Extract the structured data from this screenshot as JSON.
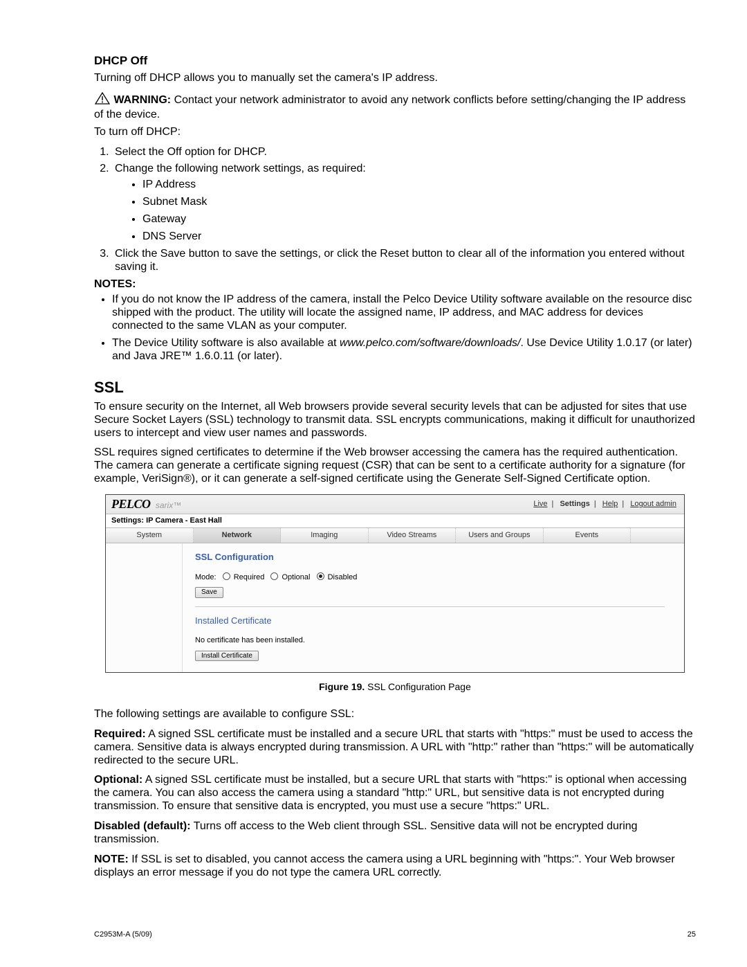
{
  "dhcp": {
    "heading": "DHCP Off",
    "intro": "Turning off DHCP allows you to manually set the camera's IP address.",
    "warning_label": "WARNING:",
    "warning_text": "Contact your network administrator to avoid any network conflicts before setting/changing the IP address of the device.",
    "turn_off_lead": "To turn off DHCP:",
    "steps": {
      "s1": "Select the Off option for DHCP.",
      "s2": "Change the following network settings, as required:",
      "s2_items": {
        "a": "IP Address",
        "b": "Subnet Mask",
        "c": "Gateway",
        "d": "DNS Server"
      },
      "s3": "Click the Save button to save the settings, or click the Reset button to clear all of the information you entered without saving it."
    },
    "notes_label": "NOTES:",
    "note1": "If you do not know the IP address of the camera, install the Pelco Device Utility software available on the resource disc shipped with the product. The utility will locate the assigned name, IP address, and MAC address for devices connected to the same VLAN as your computer.",
    "note2_a": "The Device Utility software is also available at ",
    "note2_link": "www.pelco.com/software/downloads/",
    "note2_b": ". Use Device Utility 1.0.17 (or later) and Java JRE™ 1.6.0.11 (or later)."
  },
  "ssl": {
    "heading": "SSL",
    "p1": "To ensure security on the Internet, all Web browsers provide several security levels that can be adjusted for sites that use Secure Socket Layers (SSL) technology to transmit data. SSL encrypts communications, making it difficult for unauthorized users to intercept and view user names and passwords.",
    "p2": "SSL requires signed certificates to determine if the Web browser accessing the camera has the required authentication. The camera can generate a certificate signing request (CSR) that can be sent to a certificate authority for a signature (for example, VeriSign®), or it can generate a self-signed certificate using the Generate Self-Signed Certificate option."
  },
  "shot": {
    "brand": "PELCO",
    "brand_sub": "sarix™",
    "top_links": {
      "live": "Live",
      "settings": "Settings",
      "help": "Help",
      "logout": "Logout admin"
    },
    "breadcrumb": "Settings: IP Camera - East Hall",
    "tabs": {
      "system": "System",
      "network": "Network",
      "imaging": "Imaging",
      "video": "Video Streams",
      "users": "Users and Groups",
      "events": "Events"
    },
    "h1": "SSL Configuration",
    "mode_label": "Mode:",
    "opt_required": "Required",
    "opt_optional": "Optional",
    "opt_disabled": "Disabled",
    "save": "Save",
    "h2": "Installed Certificate",
    "no_cert": "No certificate has been installed.",
    "install_btn": "Install Certificate"
  },
  "caption_fig": "Figure 19.",
  "caption_txt": "  SSL Configuration Page",
  "post": {
    "lead": "The following settings are available to configure SSL:",
    "req_label": "Required:",
    "req_text": " A signed SSL certificate must be installed and a secure URL that starts with \"https:\" must be used to access the camera. Sensitive data is always encrypted during transmission. A URL with \"http:\" rather than \"https:\" will be automatically redirected to the secure URL.",
    "opt_label": "Optional:",
    "opt_text": " A signed SSL certificate must be installed, but a secure URL that starts with \"https:\" is optional when accessing the camera. You can also access the camera using a standard \"http:\" URL, but sensitive data is not encrypted during transmission. To ensure that sensitive data is encrypted, you must use a secure \"https:\" URL.",
    "dis_label": "Disabled (default):",
    "dis_text": " Turns off access to the Web client through SSL. Sensitive data will not be encrypted during transmission.",
    "note_label": "NOTE:",
    "note_text": " If SSL is set to disabled, you cannot access the camera using a URL beginning with \"https:\". Your Web browser displays an error message if you do not type the camera URL correctly."
  },
  "footer": {
    "left": "C2953M-A  (5/09)",
    "right": "25"
  }
}
